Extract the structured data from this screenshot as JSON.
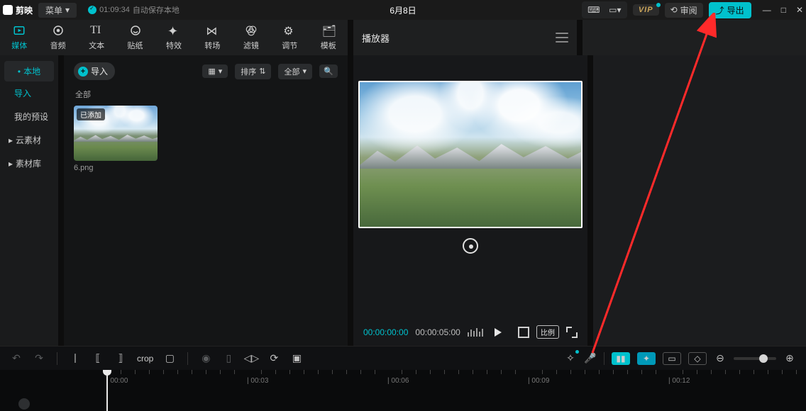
{
  "titlebar": {
    "app_name": "剪映",
    "menu_label": "菜单",
    "autosave_time": "01:09:34",
    "autosave_text": "自动保存本地",
    "doc_title": "6月8日",
    "vip_label": "VIP",
    "review_label": "审阅",
    "export_label": "导出"
  },
  "ribbon": [
    {
      "label": "媒体",
      "icon": "video"
    },
    {
      "label": "音频",
      "icon": "audio"
    },
    {
      "label": "文本",
      "icon": "text"
    },
    {
      "label": "贴纸",
      "icon": "sticker"
    },
    {
      "label": "特效",
      "icon": "fx"
    },
    {
      "label": "转场",
      "icon": "transition"
    },
    {
      "label": "滤镜",
      "icon": "filter"
    },
    {
      "label": "调节",
      "icon": "adjust"
    },
    {
      "label": "模板",
      "icon": "template"
    }
  ],
  "player_panel_title": "播放器",
  "sidebar": {
    "items": [
      {
        "label": "本地",
        "active": true,
        "caret": true
      },
      {
        "label": "导入",
        "sub": true
      },
      {
        "label": "我的预设",
        "sub": true
      },
      {
        "label": "云素材",
        "caret": true
      },
      {
        "label": "素材库",
        "caret": true
      }
    ]
  },
  "assets": {
    "import_label": "导入",
    "view_grid_label": "",
    "sort_label": "排序",
    "filter_label": "全部",
    "section_label": "全部",
    "items": [
      {
        "name": "6.png",
        "badge": "已添加"
      }
    ]
  },
  "player": {
    "current_time": "00:00:00:00",
    "duration": "00:00:05:00",
    "ratio_label": "比例"
  },
  "timeline": {
    "marks": [
      {
        "pos": 150,
        "label": "00:00"
      },
      {
        "pos": 348,
        "label": "00:03"
      },
      {
        "pos": 546,
        "label": "00:06"
      },
      {
        "pos": 744,
        "label": "00:09"
      },
      {
        "pos": 942,
        "label": "00:12"
      }
    ]
  }
}
